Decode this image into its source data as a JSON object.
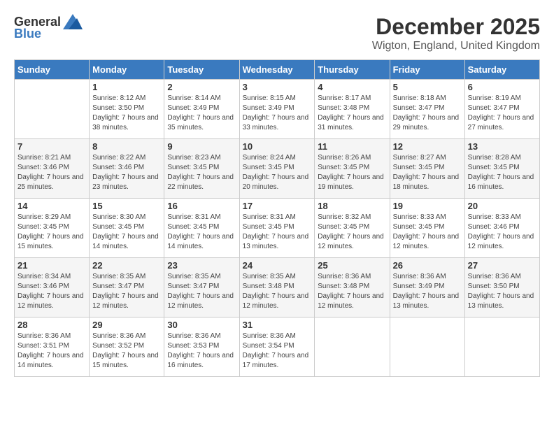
{
  "header": {
    "logo_general": "General",
    "logo_blue": "Blue",
    "month_title": "December 2025",
    "location": "Wigton, England, United Kingdom"
  },
  "weekdays": [
    "Sunday",
    "Monday",
    "Tuesday",
    "Wednesday",
    "Thursday",
    "Friday",
    "Saturday"
  ],
  "weeks": [
    [
      {
        "day": "",
        "sunrise": "",
        "sunset": "",
        "daylight": ""
      },
      {
        "day": "1",
        "sunrise": "Sunrise: 8:12 AM",
        "sunset": "Sunset: 3:50 PM",
        "daylight": "Daylight: 7 hours and 38 minutes."
      },
      {
        "day": "2",
        "sunrise": "Sunrise: 8:14 AM",
        "sunset": "Sunset: 3:49 PM",
        "daylight": "Daylight: 7 hours and 35 minutes."
      },
      {
        "day": "3",
        "sunrise": "Sunrise: 8:15 AM",
        "sunset": "Sunset: 3:49 PM",
        "daylight": "Daylight: 7 hours and 33 minutes."
      },
      {
        "day": "4",
        "sunrise": "Sunrise: 8:17 AM",
        "sunset": "Sunset: 3:48 PM",
        "daylight": "Daylight: 7 hours and 31 minutes."
      },
      {
        "day": "5",
        "sunrise": "Sunrise: 8:18 AM",
        "sunset": "Sunset: 3:47 PM",
        "daylight": "Daylight: 7 hours and 29 minutes."
      },
      {
        "day": "6",
        "sunrise": "Sunrise: 8:19 AM",
        "sunset": "Sunset: 3:47 PM",
        "daylight": "Daylight: 7 hours and 27 minutes."
      }
    ],
    [
      {
        "day": "7",
        "sunrise": "Sunrise: 8:21 AM",
        "sunset": "Sunset: 3:46 PM",
        "daylight": "Daylight: 7 hours and 25 minutes."
      },
      {
        "day": "8",
        "sunrise": "Sunrise: 8:22 AM",
        "sunset": "Sunset: 3:46 PM",
        "daylight": "Daylight: 7 hours and 23 minutes."
      },
      {
        "day": "9",
        "sunrise": "Sunrise: 8:23 AM",
        "sunset": "Sunset: 3:45 PM",
        "daylight": "Daylight: 7 hours and 22 minutes."
      },
      {
        "day": "10",
        "sunrise": "Sunrise: 8:24 AM",
        "sunset": "Sunset: 3:45 PM",
        "daylight": "Daylight: 7 hours and 20 minutes."
      },
      {
        "day": "11",
        "sunrise": "Sunrise: 8:26 AM",
        "sunset": "Sunset: 3:45 PM",
        "daylight": "Daylight: 7 hours and 19 minutes."
      },
      {
        "day": "12",
        "sunrise": "Sunrise: 8:27 AM",
        "sunset": "Sunset: 3:45 PM",
        "daylight": "Daylight: 7 hours and 18 minutes."
      },
      {
        "day": "13",
        "sunrise": "Sunrise: 8:28 AM",
        "sunset": "Sunset: 3:45 PM",
        "daylight": "Daylight: 7 hours and 16 minutes."
      }
    ],
    [
      {
        "day": "14",
        "sunrise": "Sunrise: 8:29 AM",
        "sunset": "Sunset: 3:45 PM",
        "daylight": "Daylight: 7 hours and 15 minutes."
      },
      {
        "day": "15",
        "sunrise": "Sunrise: 8:30 AM",
        "sunset": "Sunset: 3:45 PM",
        "daylight": "Daylight: 7 hours and 14 minutes."
      },
      {
        "day": "16",
        "sunrise": "Sunrise: 8:31 AM",
        "sunset": "Sunset: 3:45 PM",
        "daylight": "Daylight: 7 hours and 14 minutes."
      },
      {
        "day": "17",
        "sunrise": "Sunrise: 8:31 AM",
        "sunset": "Sunset: 3:45 PM",
        "daylight": "Daylight: 7 hours and 13 minutes."
      },
      {
        "day": "18",
        "sunrise": "Sunrise: 8:32 AM",
        "sunset": "Sunset: 3:45 PM",
        "daylight": "Daylight: 7 hours and 12 minutes."
      },
      {
        "day": "19",
        "sunrise": "Sunrise: 8:33 AM",
        "sunset": "Sunset: 3:45 PM",
        "daylight": "Daylight: 7 hours and 12 minutes."
      },
      {
        "day": "20",
        "sunrise": "Sunrise: 8:33 AM",
        "sunset": "Sunset: 3:46 PM",
        "daylight": "Daylight: 7 hours and 12 minutes."
      }
    ],
    [
      {
        "day": "21",
        "sunrise": "Sunrise: 8:34 AM",
        "sunset": "Sunset: 3:46 PM",
        "daylight": "Daylight: 7 hours and 12 minutes."
      },
      {
        "day": "22",
        "sunrise": "Sunrise: 8:35 AM",
        "sunset": "Sunset: 3:47 PM",
        "daylight": "Daylight: 7 hours and 12 minutes."
      },
      {
        "day": "23",
        "sunrise": "Sunrise: 8:35 AM",
        "sunset": "Sunset: 3:47 PM",
        "daylight": "Daylight: 7 hours and 12 minutes."
      },
      {
        "day": "24",
        "sunrise": "Sunrise: 8:35 AM",
        "sunset": "Sunset: 3:48 PM",
        "daylight": "Daylight: 7 hours and 12 minutes."
      },
      {
        "day": "25",
        "sunrise": "Sunrise: 8:36 AM",
        "sunset": "Sunset: 3:48 PM",
        "daylight": "Daylight: 7 hours and 12 minutes."
      },
      {
        "day": "26",
        "sunrise": "Sunrise: 8:36 AM",
        "sunset": "Sunset: 3:49 PM",
        "daylight": "Daylight: 7 hours and 13 minutes."
      },
      {
        "day": "27",
        "sunrise": "Sunrise: 8:36 AM",
        "sunset": "Sunset: 3:50 PM",
        "daylight": "Daylight: 7 hours and 13 minutes."
      }
    ],
    [
      {
        "day": "28",
        "sunrise": "Sunrise: 8:36 AM",
        "sunset": "Sunset: 3:51 PM",
        "daylight": "Daylight: 7 hours and 14 minutes."
      },
      {
        "day": "29",
        "sunrise": "Sunrise: 8:36 AM",
        "sunset": "Sunset: 3:52 PM",
        "daylight": "Daylight: 7 hours and 15 minutes."
      },
      {
        "day": "30",
        "sunrise": "Sunrise: 8:36 AM",
        "sunset": "Sunset: 3:53 PM",
        "daylight": "Daylight: 7 hours and 16 minutes."
      },
      {
        "day": "31",
        "sunrise": "Sunrise: 8:36 AM",
        "sunset": "Sunset: 3:54 PM",
        "daylight": "Daylight: 7 hours and 17 minutes."
      },
      {
        "day": "",
        "sunrise": "",
        "sunset": "",
        "daylight": ""
      },
      {
        "day": "",
        "sunrise": "",
        "sunset": "",
        "daylight": ""
      },
      {
        "day": "",
        "sunrise": "",
        "sunset": "",
        "daylight": ""
      }
    ]
  ]
}
